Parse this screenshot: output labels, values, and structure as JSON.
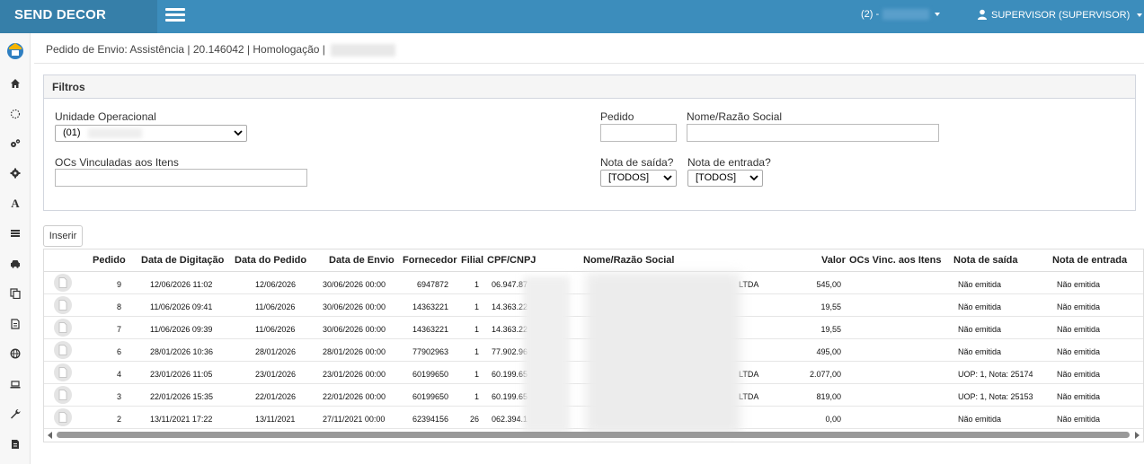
{
  "app": {
    "brand": "SEND DECOR",
    "menu_icon": "hamburger-icon"
  },
  "topbar": {
    "branch_label": "(2) -",
    "user_label": "SUPERVISOR (SUPERVISOR)"
  },
  "page": {
    "title": "Pedido de Envio: Assistência | 20.146042 | Homologação |"
  },
  "filters": {
    "title": "Filtros",
    "unidade_label": "Unidade Operacional",
    "unidade_value": "(01)",
    "ocs_label": "OCs Vinculadas aos Itens",
    "ocs_value": "",
    "pedido_label": "Pedido",
    "pedido_value": "",
    "nome_label": "Nome/Razão Social",
    "nome_value": "",
    "nota_saida_label": "Nota de saída?",
    "nota_saida_value": "[TODOS]",
    "nota_entrada_label": "Nota de entrada?",
    "nota_entrada_value": "[TODOS]"
  },
  "actions": {
    "insert_label": "Inserir"
  },
  "table": {
    "headers": {
      "pedido": "Pedido",
      "data_digitacao": "Data de Digitação",
      "data_pedido": "Data do Pedido",
      "data_envio": "Data de Envio",
      "fornecedor": "Fornecedor",
      "filial": "Filial",
      "cpf": "CPF/CNPJ",
      "nome": "Nome/Razão Social",
      "valor": "Valor",
      "ocs": "OCs Vinc. aos Itens",
      "nota_saida": "Nota de saída",
      "nota_entrada": "Nota de entrada"
    },
    "rows": [
      {
        "pedido": "9",
        "data_digitacao": "12/06/2026 11:02",
        "data_pedido": "12/06/2026",
        "data_envio": "30/06/2026 00:00",
        "fornecedor": "6947872",
        "filial": "1",
        "cpf": "06.947.87",
        "nome": "LTDA",
        "valor": "545,00",
        "ocs": "",
        "nota_saida": "Não emitida",
        "nota_entrada": "Não emitida"
      },
      {
        "pedido": "8",
        "data_digitacao": "11/06/2026 09:41",
        "data_pedido": "11/06/2026",
        "data_envio": "30/06/2026 00:00",
        "fornecedor": "14363221",
        "filial": "1",
        "cpf": "14.363.22",
        "nome": "",
        "valor": "19,55",
        "ocs": "",
        "nota_saida": "Não emitida",
        "nota_entrada": "Não emitida"
      },
      {
        "pedido": "7",
        "data_digitacao": "11/06/2026 09:39",
        "data_pedido": "11/06/2026",
        "data_envio": "30/06/2026 00:00",
        "fornecedor": "14363221",
        "filial": "1",
        "cpf": "14.363.22",
        "nome": "",
        "valor": "19,55",
        "ocs": "",
        "nota_saida": "Não emitida",
        "nota_entrada": "Não emitida"
      },
      {
        "pedido": "6",
        "data_digitacao": "28/01/2026 10:36",
        "data_pedido": "28/01/2026",
        "data_envio": "28/01/2026 00:00",
        "fornecedor": "77902963",
        "filial": "1",
        "cpf": "77.902.96",
        "nome": "",
        "valor": "495,00",
        "ocs": "",
        "nota_saida": "Não emitida",
        "nota_entrada": "Não emitida"
      },
      {
        "pedido": "4",
        "data_digitacao": "23/01/2026 11:05",
        "data_pedido": "23/01/2026",
        "data_envio": "23/01/2026 00:00",
        "fornecedor": "60199650",
        "filial": "1",
        "cpf": "60.199.65",
        "nome": "LTDA",
        "valor": "2.077,00",
        "ocs": "",
        "nota_saida": "UOP: 1, Nota: 25174",
        "nota_entrada": "Não emitida"
      },
      {
        "pedido": "3",
        "data_digitacao": "22/01/2026 15:35",
        "data_pedido": "22/01/2026",
        "data_envio": "22/01/2026 00:00",
        "fornecedor": "60199650",
        "filial": "1",
        "cpf": "60.199.65",
        "nome": "LTDA",
        "valor": "819,00",
        "ocs": "",
        "nota_saida": "UOP: 1, Nota: 25153",
        "nota_entrada": "Não emitida"
      },
      {
        "pedido": "2",
        "data_digitacao": "13/11/2021 17:22",
        "data_pedido": "13/11/2021",
        "data_envio": "27/11/2021 00:00",
        "fornecedor": "62394156",
        "filial": "26",
        "cpf": "062.394.1",
        "nome": "",
        "valor": "0,00",
        "ocs": "",
        "nota_saida": "Não emitida",
        "nota_entrada": "Não emitida"
      }
    ]
  },
  "sidebar": {
    "items": [
      {
        "icon": "home-icon"
      },
      {
        "icon": "spinner-icon"
      },
      {
        "icon": "cogs-icon"
      },
      {
        "icon": "gear-icon"
      },
      {
        "icon": "font-icon"
      },
      {
        "icon": "list-icon"
      },
      {
        "icon": "car-icon"
      },
      {
        "icon": "copy-icon"
      },
      {
        "icon": "file-text-icon"
      },
      {
        "icon": "globe-icon"
      },
      {
        "icon": "laptop-icon"
      },
      {
        "icon": "wrench-icon"
      },
      {
        "icon": "file-icon"
      }
    ]
  },
  "colors": {
    "topbar": "#3c8dbc",
    "brand": "#367fa9",
    "sidebar": "#f7f7f7"
  }
}
